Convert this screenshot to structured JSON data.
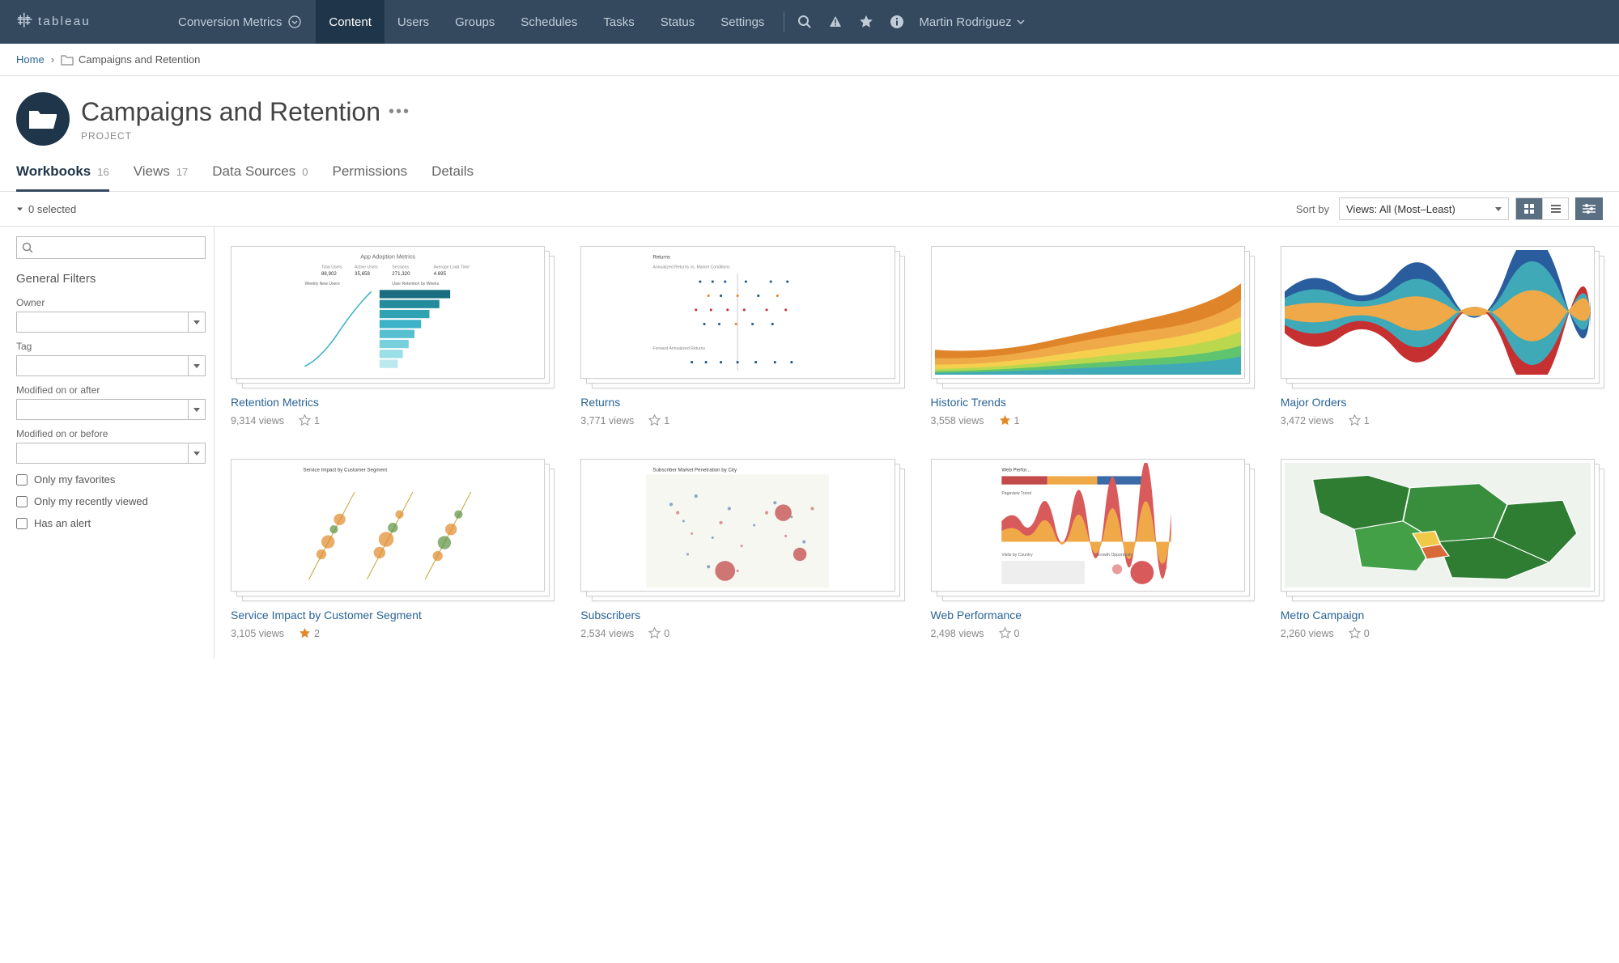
{
  "nav": {
    "site": "Conversion Metrics",
    "items": [
      "Content",
      "Users",
      "Groups",
      "Schedules",
      "Tasks",
      "Status",
      "Settings"
    ],
    "active": 0,
    "user": "Martin Rodriguez"
  },
  "breadcrumb": {
    "home": "Home",
    "current": "Campaigns and Retention"
  },
  "project": {
    "title": "Campaigns and Retention",
    "subtitle": "PROJECT"
  },
  "tabs": [
    {
      "label": "Workbooks",
      "count": "16"
    },
    {
      "label": "Views",
      "count": "17"
    },
    {
      "label": "Data Sources",
      "count": "0"
    },
    {
      "label": "Permissions",
      "count": ""
    },
    {
      "label": "Details",
      "count": ""
    }
  ],
  "toolbar": {
    "selected": "0 selected",
    "sort_label": "Sort by",
    "sort_value": "Views: All (Most–Least)"
  },
  "filters": {
    "header": "General Filters",
    "owner": "Owner",
    "tag": "Tag",
    "mod_after": "Modified on or after",
    "mod_before": "Modified on or before",
    "only_favs": "Only my favorites",
    "only_recent": "Only my recently viewed",
    "has_alert": "Has an alert"
  },
  "cards": [
    {
      "title": "Retention Metrics",
      "views": "9,314 views",
      "fav_count": "1",
      "fav_filled": false
    },
    {
      "title": "Returns",
      "views": "3,771 views",
      "fav_count": "1",
      "fav_filled": false
    },
    {
      "title": "Historic Trends",
      "views": "3,558 views",
      "fav_count": "1",
      "fav_filled": true
    },
    {
      "title": "Major Orders",
      "views": "3,472 views",
      "fav_count": "1",
      "fav_filled": false
    },
    {
      "title": "Service Impact by Customer Segment",
      "views": "3,105 views",
      "fav_count": "2",
      "fav_filled": true
    },
    {
      "title": "Subscribers",
      "views": "2,534 views",
      "fav_count": "0",
      "fav_filled": false
    },
    {
      "title": "Web Performance",
      "views": "2,498 views",
      "fav_count": "0",
      "fav_filled": false
    },
    {
      "title": "Metro Campaign",
      "views": "2,260 views",
      "fav_count": "0",
      "fav_filled": false
    }
  ]
}
